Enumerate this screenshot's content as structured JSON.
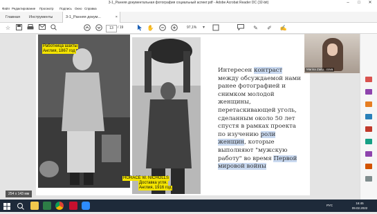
{
  "window": {
    "title": "3-1_Ранняя документальная фотография социальный аспект.pdf - Adobe Acrobat Reader DC (32-bit)",
    "controls": [
      "–",
      "□",
      "✕"
    ]
  },
  "menu": [
    "Файл",
    "Редактирование",
    "Просмотр",
    "Подпись",
    "Окно",
    "Справка"
  ],
  "tabs": {
    "home": "Главная",
    "tools": "Инструменты",
    "document": "3-1_Ранняя докум...",
    "close": "×"
  },
  "toolbar": {
    "icons": [
      "star-icon",
      "save-icon",
      "print-icon",
      "email-icon",
      "search-icon",
      "prev-page-icon",
      "next-page-icon",
      "select-cursor-icon",
      "hand-icon",
      "zoom-out-icon",
      "zoom-in-icon",
      "zoom-dropdown-icon",
      "fit-icon",
      "pen-icon",
      "highlight-icon",
      "sign-icon",
      "comment-icon"
    ],
    "page_current": "13",
    "page_total": "/ 19",
    "zoom": "97,1%"
  },
  "slide": {
    "photo1_caption_line1": "Работница шахты",
    "photo1_caption_line2": "Англия, 1867 год",
    "photo2_caption_line1": "HORACE W. NICHOLLS",
    "photo2_caption_line2": "Доставка угля.",
    "photo2_caption_line3": "Англия, 1916 год",
    "text_parts": [
      {
        "t": "Интересен ",
        "hl": false
      },
      {
        "t": "контраст",
        "hl": true
      },
      {
        "t": " между обсуждаемой нами ранее фотографией и снимком молодой женщины, перетаскивающей уголь, сделанным около 50 лет спустя в рамках проекта по изучению ",
        "hl": false
      },
      {
        "t": "роли женщин",
        "hl": true
      },
      {
        "t": ", которые выполняют \"мужскую работу\" во время ",
        "hl": false
      },
      {
        "t": "Первой мировой войны",
        "hl": true
      }
    ]
  },
  "video": {
    "name": "Marina Zaitu...cova"
  },
  "size_badge": "254 x 143 мм",
  "taskbar": {
    "lang": "РУС",
    "time": "16:45",
    "date": "09.02.2022"
  },
  "colors": {
    "highlight": "#c9d9f0",
    "caption_bg": "#f4e400",
    "taskbar": "#1e2a3a"
  }
}
